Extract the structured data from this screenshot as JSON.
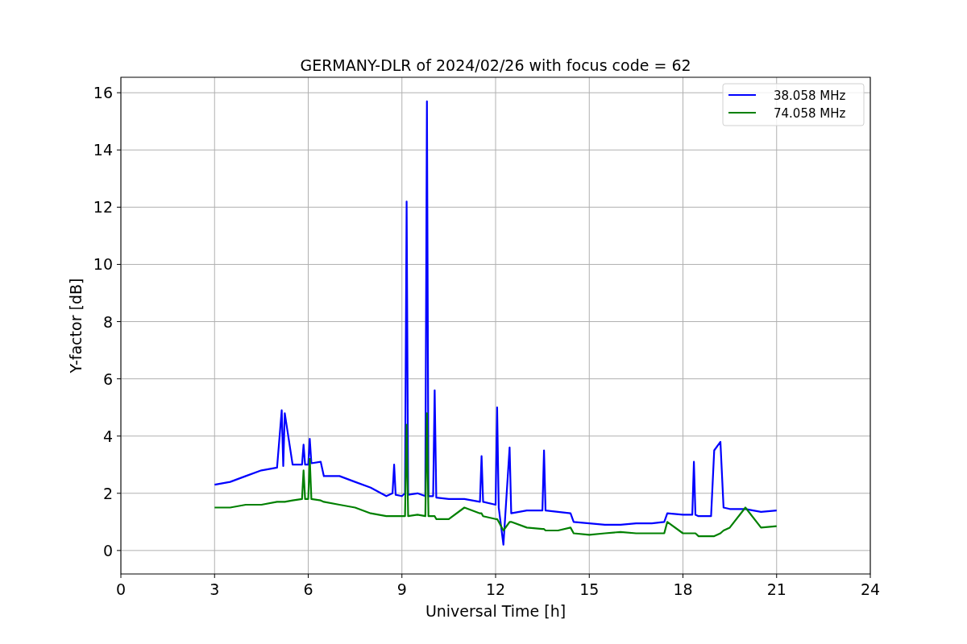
{
  "chart": {
    "chart_data": {
      "type": "line",
      "title": "GERMANY-DLR of 2024/02/26 with focus code = 62",
      "xlabel": "Universal Time [h]",
      "ylabel": "Y-factor [dB]",
      "x": [
        3,
        3.5,
        4,
        4.5,
        5,
        5.15,
        5.2,
        5.25,
        5.5,
        5.8,
        5.85,
        5.9,
        6,
        6.05,
        6.1,
        6.4,
        6.5,
        7,
        7.5,
        8,
        8.5,
        8.7,
        8.75,
        8.8,
        9,
        9.1,
        9.15,
        9.2,
        9.5,
        9.75,
        9.8,
        9.85,
        10,
        10.05,
        10.1,
        10.5,
        11,
        11.5,
        11.55,
        11.6,
        12,
        12.05,
        12.1,
        12.25,
        12.45,
        12.5,
        13,
        13.5,
        13.55,
        13.6,
        14,
        14.4,
        14.5,
        15,
        15.5,
        16,
        16.5,
        17,
        17.4,
        17.5,
        18,
        18.3,
        18.35,
        18.4,
        18.5,
        18.9,
        19,
        19.2,
        19.3,
        19.5,
        20,
        20.5,
        21
      ],
      "series": [
        {
          "name": "38.058 MHz",
          "color": "#0000ff",
          "values": [
            2.3,
            2.4,
            2.6,
            2.8,
            2.9,
            4.9,
            2.95,
            4.8,
            3.0,
            3.0,
            3.7,
            3.0,
            3.0,
            3.9,
            3.05,
            3.1,
            2.6,
            2.6,
            2.4,
            2.2,
            1.9,
            2.0,
            3.0,
            1.95,
            1.9,
            2.0,
            12.2,
            1.95,
            2.0,
            1.9,
            15.7,
            1.9,
            1.9,
            5.6,
            1.85,
            1.8,
            1.8,
            1.7,
            3.3,
            1.7,
            1.6,
            5.0,
            1.5,
            0.2,
            3.6,
            1.3,
            1.4,
            1.4,
            3.5,
            1.4,
            1.35,
            1.3,
            1.0,
            0.95,
            0.9,
            0.9,
            0.95,
            0.95,
            1.0,
            1.3,
            1.25,
            1.25,
            3.1,
            1.25,
            1.2,
            1.2,
            3.5,
            3.8,
            1.5,
            1.45,
            1.45,
            1.35,
            1.4
          ]
        },
        {
          "name": "74.058 MHz",
          "color": "#008000",
          "values": [
            1.5,
            1.5,
            1.6,
            1.6,
            1.7,
            1.7,
            1.7,
            1.7,
            1.75,
            1.8,
            2.8,
            1.8,
            1.8,
            3.2,
            1.8,
            1.75,
            1.7,
            1.6,
            1.5,
            1.3,
            1.2,
            1.2,
            1.2,
            1.2,
            1.2,
            1.2,
            4.4,
            1.2,
            1.25,
            1.2,
            4.8,
            1.2,
            1.2,
            1.2,
            1.1,
            1.1,
            1.5,
            1.3,
            1.3,
            1.2,
            1.1,
            1.1,
            1.0,
            0.7,
            1.0,
            1.0,
            0.8,
            0.75,
            0.75,
            0.7,
            0.7,
            0.8,
            0.6,
            0.55,
            0.6,
            0.65,
            0.6,
            0.6,
            0.6,
            1.0,
            0.6,
            0.6,
            0.6,
            0.6,
            0.5,
            0.5,
            0.5,
            0.6,
            0.7,
            0.8,
            1.5,
            0.8,
            0.85
          ]
        }
      ],
      "xlim": [
        0,
        24
      ],
      "ylim": [
        -0.82,
        16.54
      ],
      "grid": true,
      "legend": "upper right",
      "xticks": [
        0,
        3,
        6,
        9,
        12,
        15,
        18,
        21,
        24
      ],
      "yticks": [
        0,
        2,
        4,
        6,
        8,
        10,
        12,
        14,
        16
      ]
    }
  }
}
